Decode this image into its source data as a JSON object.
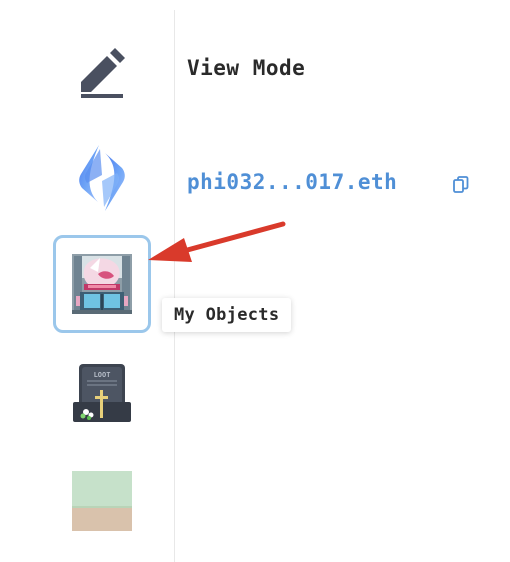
{
  "main": {
    "view_mode_label": "View Mode",
    "ens_name": "phi032...017.eth"
  },
  "tooltip": {
    "label": "My Objects"
  },
  "sidebar": {
    "items": [
      {
        "name": "edit",
        "icon": "pencil-icon"
      },
      {
        "name": "ens",
        "icon": "ens-logo-icon"
      },
      {
        "name": "my-objects",
        "icon": "shop-object-icon",
        "selected": true
      },
      {
        "name": "loot",
        "icon": "loot-tombstone-icon",
        "engraving": "LOOT"
      },
      {
        "name": "land",
        "icon": "land-tile-icon"
      }
    ]
  },
  "colors": {
    "accent_blue": "#4f8fd6",
    "selected_border": "#9bc7eb",
    "annotation_arrow": "#d93a2b",
    "text_dark": "#2a2a2a"
  }
}
